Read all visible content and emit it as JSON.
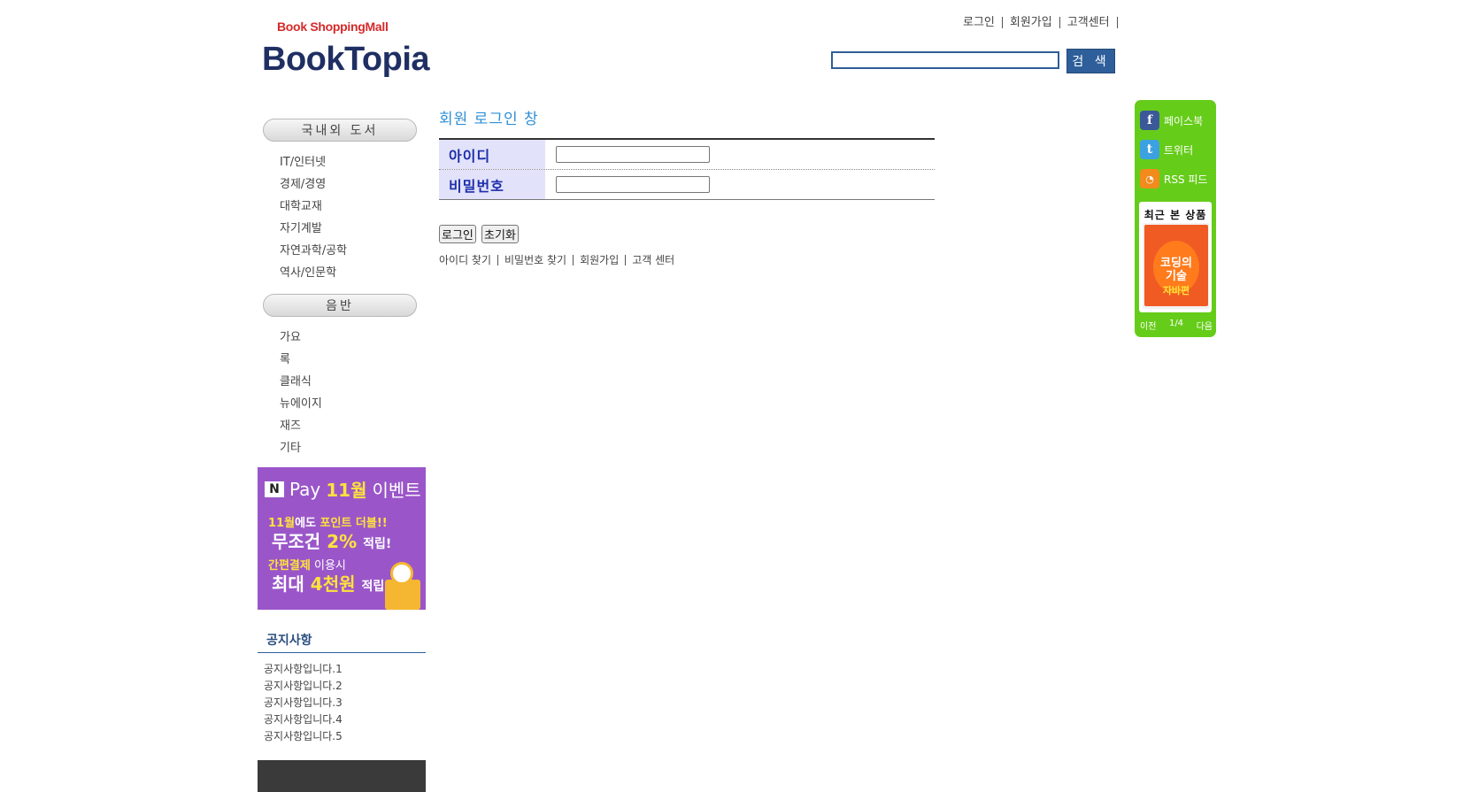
{
  "logo": {
    "subtitle": "Book ShoppingMall",
    "title": "BookTopia"
  },
  "top_links": [
    "로그인",
    "회원가입",
    "고객센터"
  ],
  "search": {
    "button_label": "검 색",
    "value": ""
  },
  "sidebar": {
    "categories": [
      {
        "title": "국내외 도서",
        "items": [
          "IT/인터넷",
          "경제/경영",
          "대학교재",
          "자기계발",
          "자연과학/공학",
          "역사/인문학"
        ]
      },
      {
        "title": "음반",
        "items": [
          "가요",
          "록",
          "클래식",
          "뉴에이지",
          "재즈",
          "기타"
        ]
      }
    ],
    "banner": {
      "logo_letter": "N",
      "line1_a": "Pay",
      "line1_b": "11월",
      "line1_c": "이벤트",
      "line2_a": "11월",
      "line2_b": "에도",
      "line2_c": "포인트 더블!!",
      "line3_a": "무조건",
      "line3_b": "2%",
      "line3_c": "적립!",
      "line4_a": "간편결제",
      "line4_b": "이용시",
      "line5_a": "최대",
      "line5_b": "4천원",
      "line5_c": "적립!"
    },
    "notice": {
      "title": "공지사항",
      "items": [
        "공지사항입니다.1",
        "공지사항입니다.2",
        "공지사항입니다.3",
        "공지사항입니다.4",
        "공지사항입니다.5"
      ]
    }
  },
  "login": {
    "title": "회원 로그인 창",
    "id_label": "아이디",
    "pw_label": "비밀번호",
    "id_value": "",
    "pw_value": "",
    "login_button": "로그인",
    "reset_button": "초기화",
    "links": [
      "아이디 찾기",
      "비밀번호 찾기",
      "회원가입",
      "고객 센터"
    ]
  },
  "right_panel": {
    "social": [
      {
        "label": "페이스북",
        "icon": "facebook-icon",
        "color": "#3b5998"
      },
      {
        "label": "트위터",
        "icon": "twitter-icon",
        "color": "#3ba1e0"
      },
      {
        "label": "RSS 피드",
        "icon": "rss-icon",
        "color": "#f28a1c"
      }
    ],
    "recent_title": "최근 본 상품",
    "book_title_1": "코딩의",
    "book_title_2": "기술",
    "book_subtitle": "자바편",
    "prev": "이전",
    "page": "1/4",
    "next": "다음"
  },
  "colors": {
    "brand": "#1f2f63",
    "accent": "#2f5f9a",
    "green_panel": "#66cc1a",
    "banner_purple": "#9a56c9"
  }
}
